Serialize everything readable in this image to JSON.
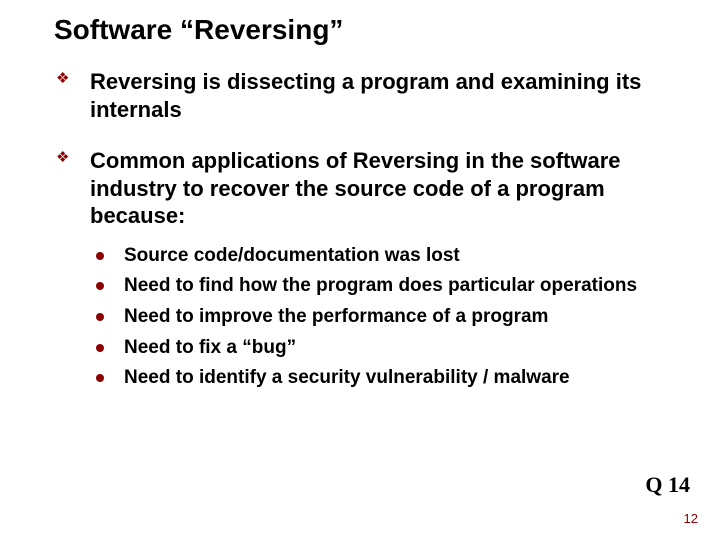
{
  "title": "Software “Reversing”",
  "bullets": [
    {
      "text": "Reversing is dissecting a program and examining its internals"
    },
    {
      "text": "Common applications of Reversing in the software industry to recover the source code of a program because:",
      "sub": [
        "Source code/documentation was lost",
        "Need to find how the program does particular operations",
        "Need to improve the performance of a program",
        "Need to fix a “bug”",
        "Need to identify a security vulnerability / malware"
      ]
    }
  ],
  "question_label": "Q 14",
  "page_number": "12"
}
